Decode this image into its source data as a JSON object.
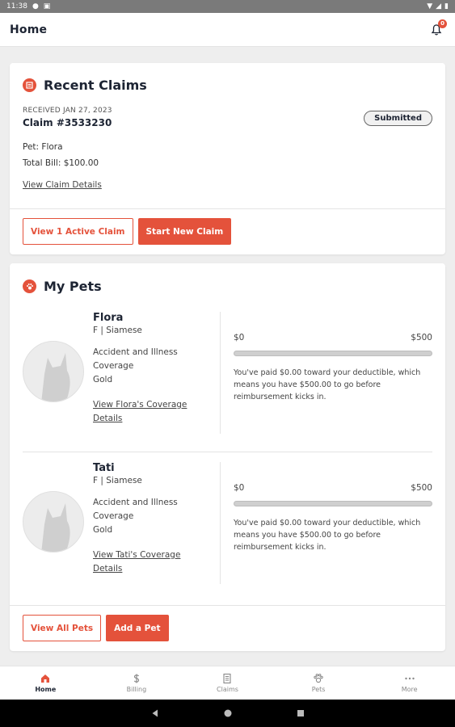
{
  "status_bar": {
    "time": "11:38"
  },
  "header": {
    "title": "Home",
    "notification_count": "0"
  },
  "recent_claims": {
    "heading": "Recent Claims",
    "received": "RECEIVED JAN 27, 2023",
    "claim_number": "Claim #3533230",
    "status": "Submitted",
    "pet_line": "Pet: Flora",
    "bill_line": "Total Bill: $100.00",
    "details_link": "View Claim Details",
    "view_active_label": "View 1 Active Claim",
    "start_new_label": "Start New Claim"
  },
  "my_pets": {
    "heading": "My Pets",
    "pets": [
      {
        "name": "Flora",
        "sub": "F | Siamese",
        "coverage": "Accident and Illness Coverage",
        "tier": "Gold",
        "link": "View Flora's Coverage Details",
        "min": "$0",
        "max": "$500",
        "paid_fraction": 0,
        "desc": "You've paid $0.00 toward your deductible, which means you have $500.00 to go before reimbursement kicks in."
      },
      {
        "name": "Tati",
        "sub": "F | Siamese",
        "coverage": "Accident and Illness Coverage",
        "tier": "Gold",
        "link": "View Tati's Coverage Details",
        "min": "$0",
        "max": "$500",
        "paid_fraction": 0,
        "desc": "You've paid $0.00 toward your deductible, which means you have $500.00 to go before reimbursement kicks in."
      }
    ],
    "view_all_label": "View All Pets",
    "add_pet_label": "Add a Pet"
  },
  "nav": {
    "items": [
      {
        "label": "Home",
        "icon": "home-icon"
      },
      {
        "label": "Billing",
        "icon": "dollar-icon"
      },
      {
        "label": "Claims",
        "icon": "document-icon"
      },
      {
        "label": "Pets",
        "icon": "paw-icon"
      },
      {
        "label": "More",
        "icon": "more-icon"
      }
    ]
  },
  "colors": {
    "accent": "#e4523b",
    "text": "#1d2433"
  }
}
